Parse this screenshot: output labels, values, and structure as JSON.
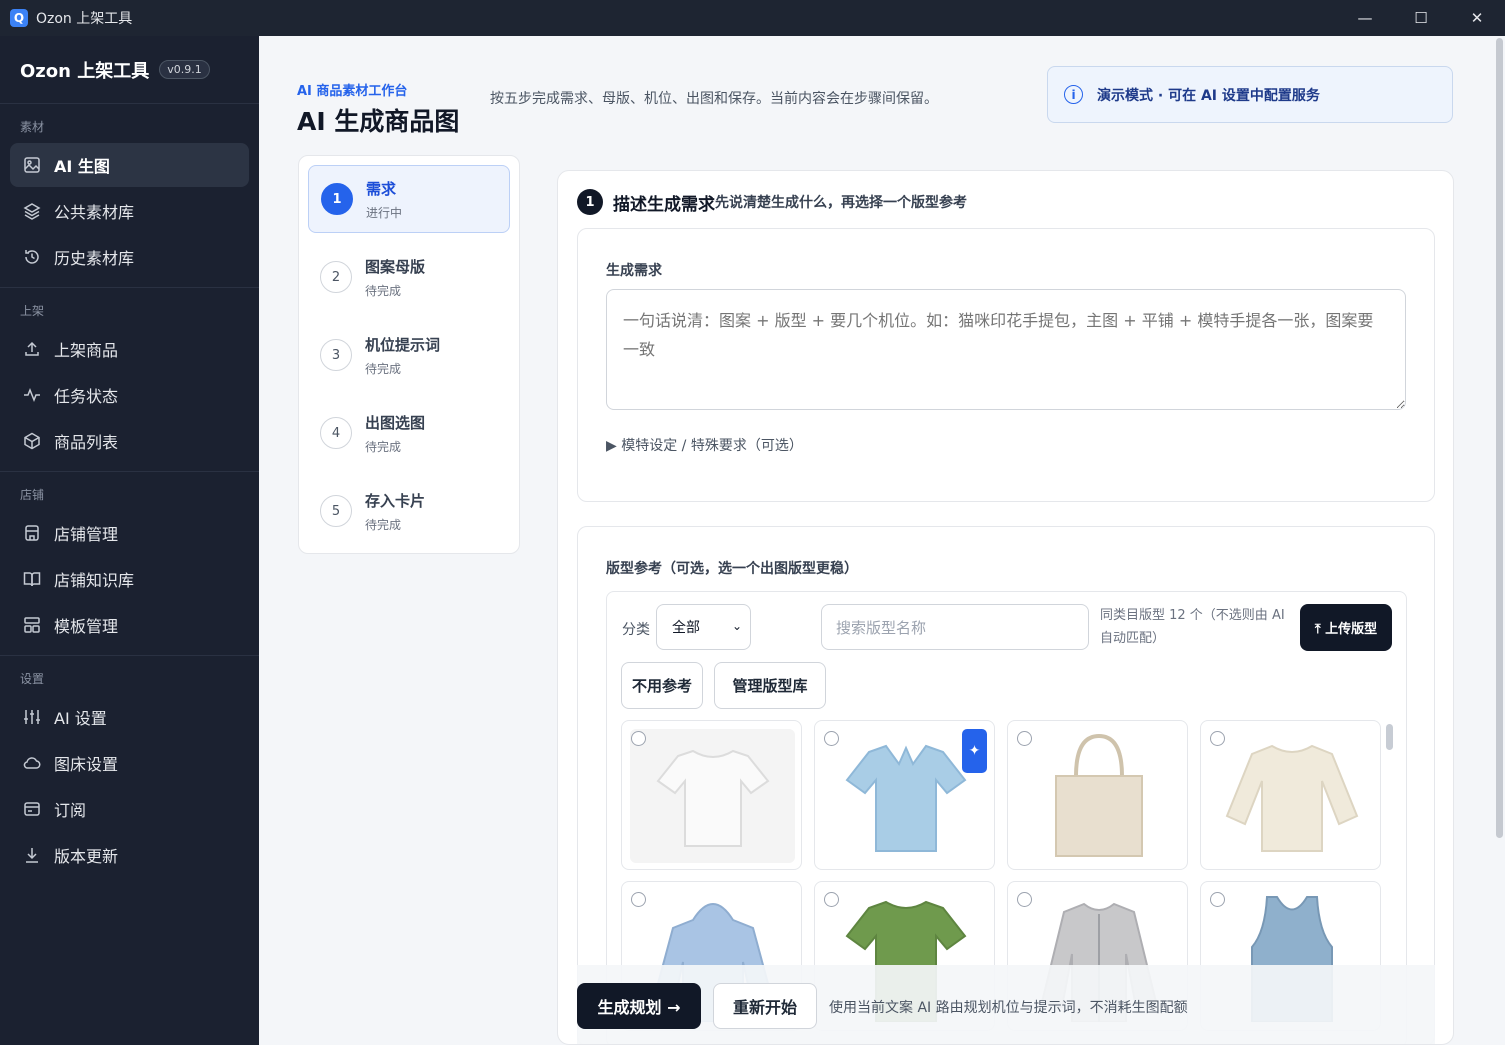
{
  "window": {
    "title": "Ozon 上架工具",
    "logo": "Q"
  },
  "window_controls": {
    "minimize": "—",
    "maximize": "☐",
    "close": "✕"
  },
  "sidebar": {
    "brand": "Ozon 上架工具",
    "version": "v0.9.1",
    "sections": [
      {
        "label": "素材",
        "items": [
          "AI 生图",
          "公共素材库",
          "历史素材库"
        ]
      },
      {
        "label": "上架",
        "items": [
          "上架商品",
          "任务状态",
          "商品列表"
        ]
      },
      {
        "label": "店铺",
        "items": [
          "店铺管理",
          "店铺知识库",
          "模板管理"
        ]
      },
      {
        "label": "设置",
        "items": [
          "AI 设置",
          "图床设置",
          "订阅",
          "版本更新"
        ]
      }
    ],
    "active_item": "AI 生图"
  },
  "header": {
    "kicker": "AI 商品素材工作台",
    "title": "AI 生成商品图",
    "description": "按五步完成需求、母版、机位、出图和保存。当前内容会在步骤间保留。",
    "demo_notice": "演示模式 · 可在 AI 设置中配置服务"
  },
  "steps": [
    {
      "num": "1",
      "title": "需求",
      "status": "进行中"
    },
    {
      "num": "2",
      "title": "图案母版",
      "status": "待完成"
    },
    {
      "num": "3",
      "title": "机位提示词",
      "status": "待完成"
    },
    {
      "num": "4",
      "title": "出图选图",
      "status": "待完成"
    },
    {
      "num": "5",
      "title": "存入卡片",
      "status": "待完成"
    }
  ],
  "section": {
    "num": "1",
    "title": "描述生成需求",
    "subtitle": "先说清楚生成什么，再选择一个版型参考"
  },
  "requirement": {
    "label": "生成需求",
    "placeholder": "一句话说清：图案 + 版型 + 要几个机位。如：猫咪印花手提包，主图 + 平铺 + 模特手提各一张，图案要一致",
    "expander": "▶ 模特设定 / 特殊要求（可选）"
  },
  "template_ref": {
    "label": "版型参考（可选，选一个出图版型更稳）",
    "filter_label": "分类",
    "category_value": "全部",
    "search_placeholder": "搜索版型名称",
    "count_note": "同类目版型 12 个（不选则由 AI 自动匹配）",
    "upload_button": "⤒ 上传版型",
    "no_ref_button": "不用参考",
    "manage_button": "管理版型库",
    "items": [
      {
        "name": "white-tshirt",
        "color": "#f3f3f1"
      },
      {
        "name": "blue-polo",
        "color": "#a9cde6"
      },
      {
        "name": "canvas-tote",
        "color": "#e8dfcf"
      },
      {
        "name": "cream-sweatshirt",
        "color": "#f0eadb"
      },
      {
        "name": "blue-hoodie",
        "color": "#a9c4e4"
      },
      {
        "name": "green-tshirt",
        "color": "#6f9a4d"
      },
      {
        "name": "grey-zip-jacket",
        "color": "#c8c8ca"
      },
      {
        "name": "blue-tank-top",
        "color": "#8fb0cc"
      }
    ]
  },
  "actions": {
    "generate": "生成规划 →",
    "reset": "重新开始",
    "note": "使用当前文案 AI 路由规划机位与提示词，不消耗生图配额"
  }
}
